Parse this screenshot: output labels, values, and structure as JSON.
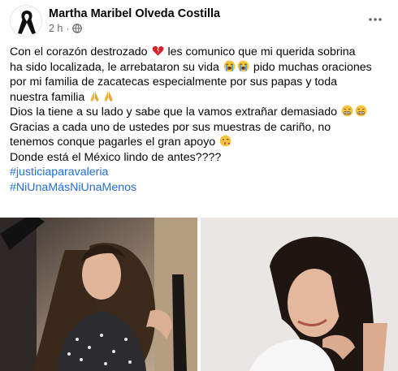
{
  "post": {
    "author": "Martha Maribel Olveda Costilla",
    "time": "2 h",
    "separator": "·",
    "lines": {
      "l1a": "Con el corazón destrozado",
      "l1b": "les comunico que mi querida sobrina",
      "l2a": "ha sido localizada, le arrebataron su vida",
      "l2b": "pido muchas oraciones",
      "l3": "por mi familia de zacatecas especialmente por sus papas y toda",
      "l4": "nuestra familia",
      "l5": "Dios la tiene a su lado y sabe que la vamos extrañar demasiado",
      "l6": "Gracias a cada uno de ustedes por sus muestras de cariño, no",
      "l7": "tenemos conque pagarles  el gran apoyo",
      "l8": "Donde está el México lindo de antes????"
    },
    "hashtags": [
      "#justiciaparavaleria",
      "#NiUnaMásNiUnaMenos"
    ],
    "icons": {
      "avatar": "black-ribbon-icon",
      "audience": "globe-icon",
      "more": "more-options-icon",
      "emoji_broken_heart": "broken-heart-emoji",
      "emoji_crying": "loudly-crying-emoji",
      "emoji_pray": "folded-hands-emoji",
      "emoji_grimace": "grimacing-emoji",
      "emoji_kiss": "face-blowing-kiss-emoji"
    },
    "colors": {
      "hashtag": "#216fdb",
      "meta": "#65676b",
      "text": "#050505"
    }
  }
}
